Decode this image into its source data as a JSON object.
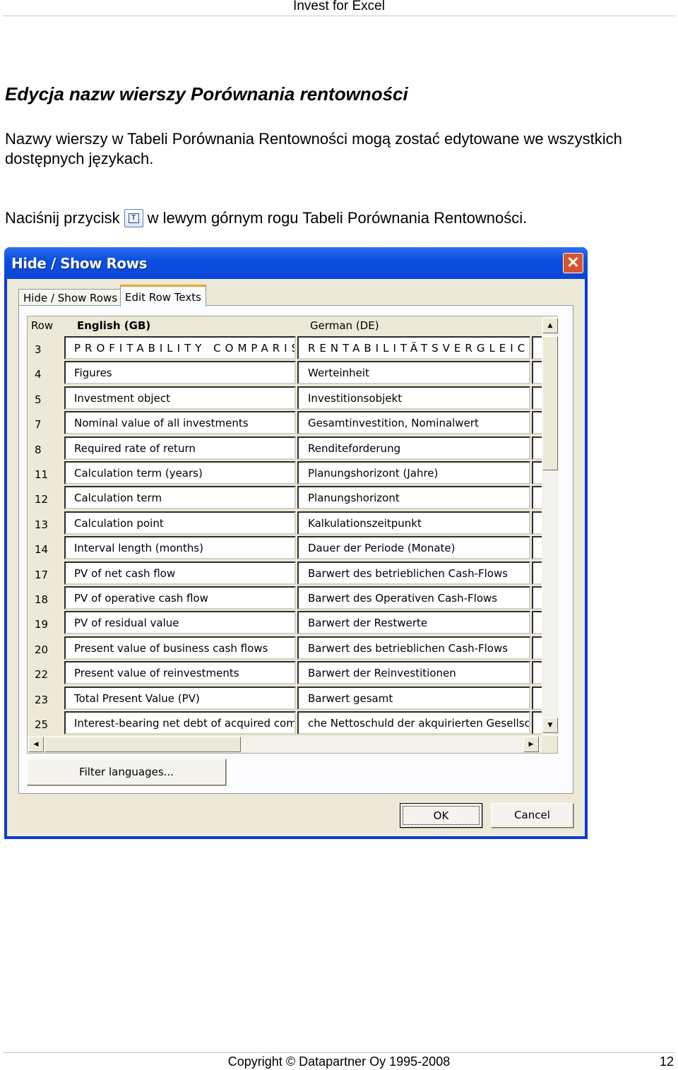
{
  "header": {
    "title": "Invest for Excel"
  },
  "heading": "Edycja nazw wierszy Porównania rentowności",
  "paragraph1": "Nazwy wierszy w Tabeli Porównania Rentowności mogą zostać edytowane we wszystkich dostępnych językach.",
  "paragraph2": {
    "before": "Naciśnij przycisk",
    "after": "w lewym górnym rogu Tabeli Porównania Rentowności.",
    "icon": "edit-texts-icon",
    "icon_glyph": "T"
  },
  "dialog": {
    "title": "Hide / Show Rows",
    "close_glyph": "✕",
    "tabs": [
      {
        "label": "Hide / Show Rows",
        "active": false
      },
      {
        "label": "Edit Row Texts",
        "active": true
      }
    ],
    "columns": {
      "row": "Row",
      "english": "English (GB)",
      "german": "German (DE)"
    },
    "rows": [
      {
        "row": "3",
        "en": "PROFITABILITY COMPARISON",
        "de": "RENTABILITÄTSVERGLEICH"
      },
      {
        "row": "4",
        "en": "Figures",
        "de": "Werteinheit"
      },
      {
        "row": "5",
        "en": "Investment object",
        "de": "Investitionsobjekt"
      },
      {
        "row": "7",
        "en": "Nominal value of all investments",
        "de": "Gesamtinvestition, Nominalwert"
      },
      {
        "row": "8",
        "en": "Required rate of return",
        "de": "Renditeforderung"
      },
      {
        "row": "11",
        "en": "Calculation term (years)",
        "de": "Planungshorizont (Jahre)"
      },
      {
        "row": "12",
        "en": "Calculation term",
        "de": "Planungshorizont"
      },
      {
        "row": "13",
        "en": "Calculation point",
        "de": "Kalkulationszeitpunkt"
      },
      {
        "row": "14",
        "en": "Interval length (months)",
        "de": "Dauer der Periode (Monate)"
      },
      {
        "row": "17",
        "en": "PV of net cash flow",
        "de": "Barwert des betrieblichen Cash-Flows"
      },
      {
        "row": "18",
        "en": "PV of operative cash flow",
        "de": "Barwert des Operativen Cash-Flows"
      },
      {
        "row": "19",
        "en": "PV of residual value",
        "de": "Barwert der Restwerte"
      },
      {
        "row": "20",
        "en": "Present value of business cash flows",
        "de": "Barwert des betrieblichen Cash-Flows"
      },
      {
        "row": "22",
        "en": "Present value of reinvestments",
        "de": "Barwert der Reinvestitionen"
      },
      {
        "row": "23",
        "en": "Total Present Value (PV)",
        "de": "Barwert gesamt"
      },
      {
        "row": "25",
        "en": "Interest-bearing net debt of acquired compa",
        "de": "che Nettoschuld der akquirierten Gesellschaft"
      }
    ],
    "filter_button": "Filter languages...",
    "ok_button": "OK",
    "cancel_button": "Cancel"
  },
  "footer": {
    "copyright": "Copyright © Datapartner Oy 1995-2008",
    "page": "12"
  }
}
